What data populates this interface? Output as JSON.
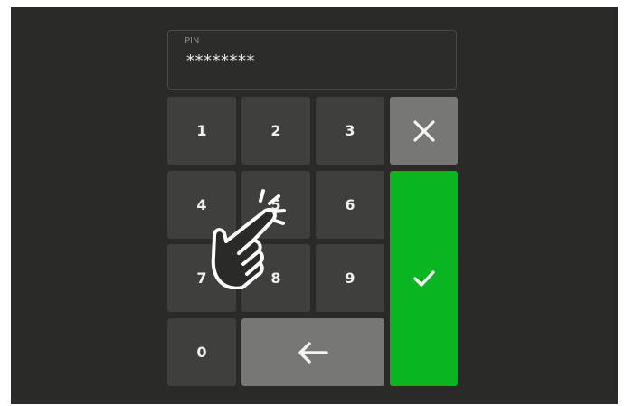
{
  "pin": {
    "label": "PIN",
    "value": "********"
  },
  "keypad": {
    "digits": [
      "1",
      "2",
      "3",
      "4",
      "5",
      "6",
      "7",
      "8",
      "9",
      "0"
    ]
  },
  "icons": {
    "clear": "close-icon",
    "confirm": "checkmark-icon",
    "backspace": "arrow-left-icon",
    "gesture": "tap-hand-icon"
  },
  "colors": {
    "background": "#2a2a29",
    "key": "#3f3f3e",
    "key_light": "#777776",
    "confirm": "#09b622",
    "text": "#f0f0f0"
  }
}
